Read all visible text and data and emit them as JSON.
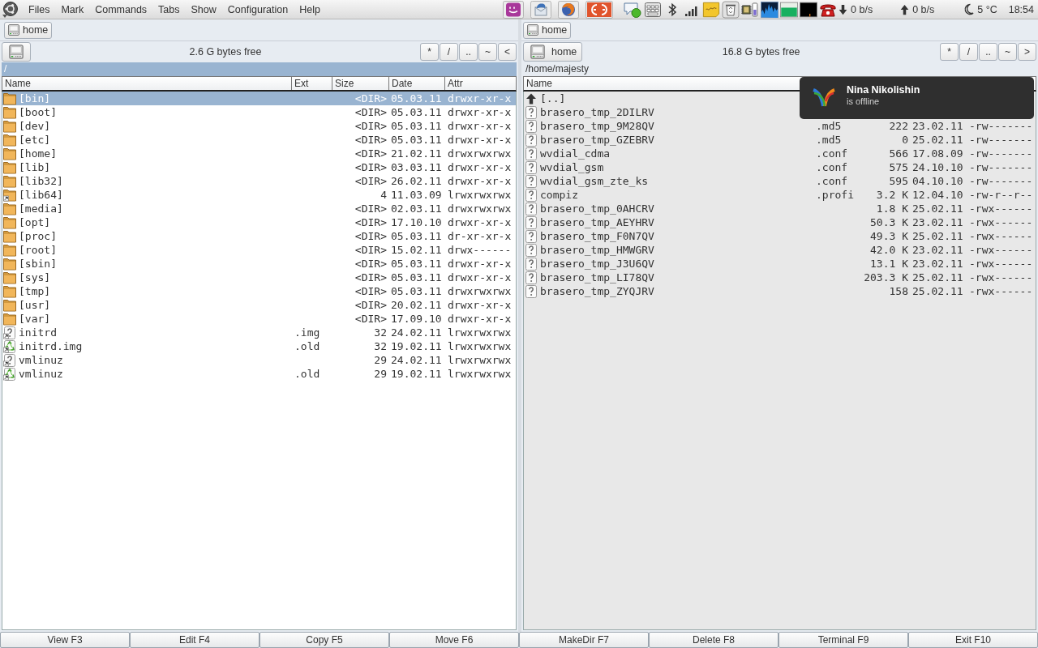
{
  "menu_bar": {
    "items": [
      "Files",
      "Mark",
      "Commands",
      "Tabs",
      "Show",
      "Configuration",
      "Help"
    ]
  },
  "tray": {
    "download_rate": "0 b/s",
    "upload_rate": "0 b/s",
    "temperature": "5 °C",
    "clock": "18:54"
  },
  "panels": [
    {
      "active": true,
      "tabs": [
        "home"
      ],
      "free_space": "2.6 G bytes free",
      "nav_buttons": [
        "*",
        "/",
        "..",
        "~",
        "<"
      ],
      "path": "/",
      "columns": [
        "Name",
        "Ext",
        "Size",
        "Date",
        "Attr"
      ],
      "rows": [
        {
          "kind": "folder",
          "name": "[bin]",
          "size": "<DIR>",
          "date": "05.03.11",
          "attr": "drwxr-xr-x",
          "selected": true
        },
        {
          "kind": "folder",
          "name": "[boot]",
          "size": "<DIR>",
          "date": "05.03.11",
          "attr": "drwxr-xr-x",
          "selected": false
        },
        {
          "kind": "folder",
          "name": "[dev]",
          "size": "<DIR>",
          "date": "05.03.11",
          "attr": "drwxr-xr-x",
          "selected": false
        },
        {
          "kind": "folder",
          "name": "[etc]",
          "size": "<DIR>",
          "date": "05.03.11",
          "attr": "drwxr-xr-x",
          "selected": false
        },
        {
          "kind": "folder",
          "name": "[home]",
          "size": "<DIR>",
          "date": "21.02.11",
          "attr": "drwxrwxrwx",
          "selected": false
        },
        {
          "kind": "folder",
          "name": "[lib]",
          "size": "<DIR>",
          "date": "03.03.11",
          "attr": "drwxr-xr-x",
          "selected": false
        },
        {
          "kind": "folder",
          "name": "[lib32]",
          "size": "<DIR>",
          "date": "26.02.11",
          "attr": "drwxr-xr-x",
          "selected": false
        },
        {
          "kind": "folder-link",
          "name": "[lib64]",
          "size": "4",
          "date": "11.03.09",
          "attr": "lrwxrwxrwx",
          "selected": false
        },
        {
          "kind": "folder",
          "name": "[media]",
          "size": "<DIR>",
          "date": "02.03.11",
          "attr": "drwxrwxrwx",
          "selected": false
        },
        {
          "kind": "folder",
          "name": "[opt]",
          "size": "<DIR>",
          "date": "17.10.10",
          "attr": "drwxr-xr-x",
          "selected": false
        },
        {
          "kind": "folder",
          "name": "[proc]",
          "size": "<DIR>",
          "date": "05.03.11",
          "attr": "dr-xr-xr-x",
          "selected": false
        },
        {
          "kind": "folder",
          "name": "[root]",
          "size": "<DIR>",
          "date": "15.02.11",
          "attr": "drwx------",
          "selected": false
        },
        {
          "kind": "folder",
          "name": "[sbin]",
          "size": "<DIR>",
          "date": "05.03.11",
          "attr": "drwxr-xr-x",
          "selected": false
        },
        {
          "kind": "folder",
          "name": "[sys]",
          "size": "<DIR>",
          "date": "05.03.11",
          "attr": "drwxr-xr-x",
          "selected": false
        },
        {
          "kind": "folder",
          "name": "[tmp]",
          "size": "<DIR>",
          "date": "05.03.11",
          "attr": "drwxrwxrwx",
          "selected": false
        },
        {
          "kind": "folder",
          "name": "[usr]",
          "size": "<DIR>",
          "date": "20.02.11",
          "attr": "drwxr-xr-x",
          "selected": false
        },
        {
          "kind": "folder",
          "name": "[var]",
          "size": "<DIR>",
          "date": "17.09.10",
          "attr": "drwxr-xr-x",
          "selected": false
        },
        {
          "kind": "unknown-link",
          "name": "initrd",
          "ext": ".img",
          "size": "32",
          "date": "24.02.11",
          "attr": "lrwxrwxrwx",
          "selected": false
        },
        {
          "kind": "recycle-link",
          "name": "initrd.img",
          "ext": ".old",
          "size": "32",
          "date": "19.02.11",
          "attr": "lrwxrwxrwx",
          "selected": false
        },
        {
          "kind": "unknown-link",
          "name": "vmlinuz",
          "size": "29",
          "date": "24.02.11",
          "attr": "lrwxrwxrwx",
          "selected": false
        },
        {
          "kind": "recycle-link",
          "name": "vmlinuz",
          "ext": ".old",
          "size": "29",
          "date": "19.02.11",
          "attr": "lrwxrwxrwx",
          "selected": false
        }
      ]
    },
    {
      "active": false,
      "tabs": [
        "home"
      ],
      "drive_label": "home",
      "free_space": "16.8 G bytes free",
      "nav_buttons": [
        "*",
        "/",
        "..",
        "~",
        ">"
      ],
      "path": "/home/majesty",
      "columns": [
        "Name"
      ],
      "rows": [
        {
          "kind": "up",
          "name": "[..]",
          "selected": false
        },
        {
          "kind": "unknown",
          "name": "brasero_tmp_2DILRV",
          "selected": false
        },
        {
          "kind": "unknown",
          "name": "brasero_tmp_9M28QV",
          "ext": ".md5",
          "size": "222",
          "date": "23.02.11",
          "attr": "-rw-------",
          "selected": false
        },
        {
          "kind": "unknown",
          "name": "brasero_tmp_GZEBRV",
          "ext": ".md5",
          "size": "0",
          "date": "25.02.11",
          "attr": "-rw-------",
          "selected": false
        },
        {
          "kind": "unknown",
          "name": "wvdial_cdma",
          "ext": ".conf",
          "size": "566",
          "date": "17.08.09",
          "attr": "-rw-------",
          "selected": false
        },
        {
          "kind": "unknown",
          "name": "wvdial_gsm",
          "ext": ".conf",
          "size": "575",
          "date": "24.10.10",
          "attr": "-rw-------",
          "selected": false
        },
        {
          "kind": "unknown",
          "name": "wvdial_gsm_zte_ks",
          "ext": ".conf",
          "size": "595",
          "date": "04.10.10",
          "attr": "-rw-------",
          "selected": false
        },
        {
          "kind": "unknown",
          "name": "compiz",
          "ext": ".profi",
          "size": "3.2 K",
          "date": "12.04.10",
          "attr": "-rw-r--r--",
          "selected": false
        },
        {
          "kind": "unknown",
          "name": "brasero_tmp_0AHCRV",
          "size": "1.8 K",
          "date": "25.02.11",
          "attr": "-rwx------",
          "selected": false
        },
        {
          "kind": "unknown",
          "name": "brasero_tmp_AEYHRV",
          "size": "50.3 K",
          "date": "23.02.11",
          "attr": "-rwx------",
          "selected": false
        },
        {
          "kind": "unknown",
          "name": "brasero_tmp_F0N7QV",
          "size": "49.3 K",
          "date": "25.02.11",
          "attr": "-rwx------",
          "selected": false
        },
        {
          "kind": "unknown",
          "name": "brasero_tmp_HMWGRV",
          "size": "42.0 K",
          "date": "23.02.11",
          "attr": "-rwx------",
          "selected": false
        },
        {
          "kind": "unknown",
          "name": "brasero_tmp_J3U6QV",
          "size": "13.1 K",
          "date": "23.02.11",
          "attr": "-rwx------",
          "selected": false
        },
        {
          "kind": "unknown",
          "name": "brasero_tmp_LI78QV",
          "size": "203.3 K",
          "date": "25.02.11",
          "attr": "-rwx------",
          "selected": false
        },
        {
          "kind": "unknown",
          "name": "brasero_tmp_ZYQJRV",
          "size": "158",
          "date": "25.02.11",
          "attr": "-rwx------",
          "selected": false
        }
      ]
    }
  ],
  "function_keys": [
    "View F3",
    "Edit F4",
    "Copy F5",
    "Move F6",
    "MakeDir F7",
    "Delete F8",
    "Terminal F9",
    "Exit F10"
  ],
  "notification": {
    "title": "Nina Nikolishin",
    "message": "is offline"
  }
}
